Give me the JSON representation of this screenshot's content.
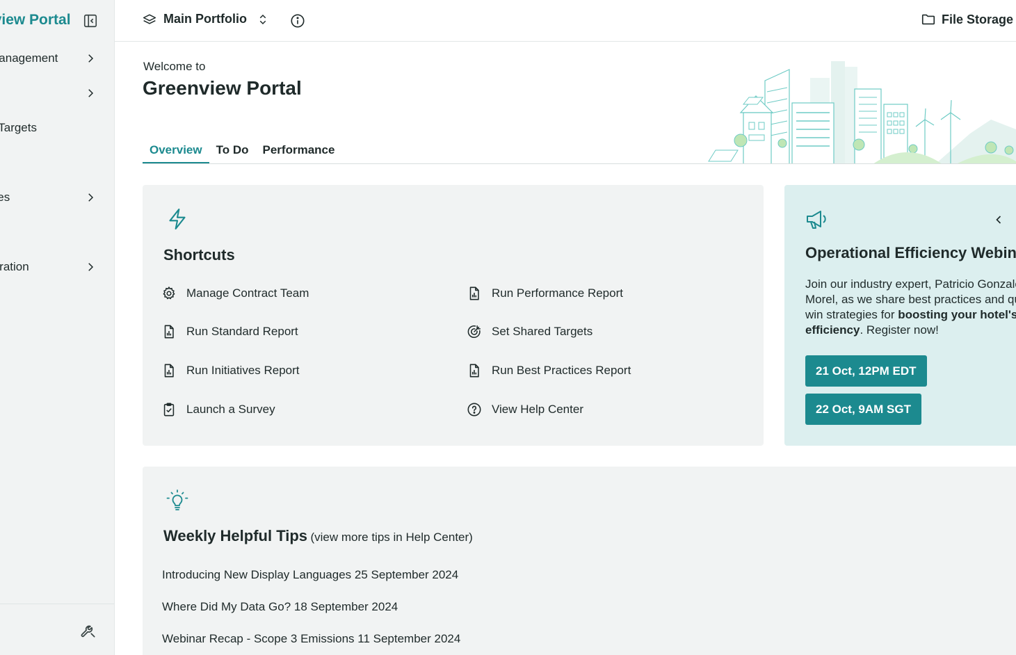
{
  "colors": {
    "accent": "#1c8a8f",
    "sidebar_bg": "#f1f3f3",
    "promo_bg": "#dcefef",
    "text": "#1f2a2a"
  },
  "sidebar": {
    "brand": "Greenview Portal",
    "items": [
      {
        "label": "Account Management",
        "icon": "chevron-right-icon"
      },
      {
        "label": "",
        "icon": "chevron-right-icon"
      },
      {
        "label": "Shared Targets",
        "icon": ""
      },
      {
        "label": "Resources",
        "icon": "chevron-right-icon"
      },
      {
        "label": "Administration",
        "icon": "chevron-right-icon"
      }
    ],
    "bottom_icon": "wrench-icon"
  },
  "topbar": {
    "portfolio": "Main Portfolio",
    "file_storage": "File Storage"
  },
  "welcome": {
    "small": "Welcome to",
    "title": "Greenview Portal"
  },
  "tabs": [
    {
      "label": "Overview",
      "active": true
    },
    {
      "label": "To Do",
      "active": false
    },
    {
      "label": "Performance",
      "active": false
    }
  ],
  "shortcuts": {
    "title": "Shortcuts",
    "items": [
      {
        "label": "Manage Contract Team",
        "icon": "gear-icon"
      },
      {
        "label": "Run Performance Report",
        "icon": "report-icon"
      },
      {
        "label": "Run Standard Report",
        "icon": "report-icon"
      },
      {
        "label": "Set Shared Targets",
        "icon": "target-icon"
      },
      {
        "label": "Run Initiatives Report",
        "icon": "report-icon"
      },
      {
        "label": "Run Best Practices Report",
        "icon": "report-icon"
      },
      {
        "label": "Launch a Survey",
        "icon": "clipboard-check-icon"
      },
      {
        "label": "View Help Center",
        "icon": "help-circle-icon"
      }
    ]
  },
  "promo": {
    "title": "Operational Efficiency Webinar",
    "body_1": "Join our industry expert, Patricio Gonzalez Morel, as we share best practices and quick-win strategies for ",
    "body_bold_1": "boosting your hotel's efficiency",
    "body_2": ". Register now!",
    "date_1": "21 Oct, 12PM EDT",
    "date_2": "22 Oct, 9AM SGT"
  },
  "tips": {
    "title": "Weekly Helpful Tips",
    "subtitle": "(view more tips in Help Center)",
    "items": [
      "Introducing New Display Languages 25 September 2024",
      "Where Did My Data Go? 18 September 2024",
      "Webinar Recap - Scope 3 Emissions 11 September 2024"
    ]
  }
}
